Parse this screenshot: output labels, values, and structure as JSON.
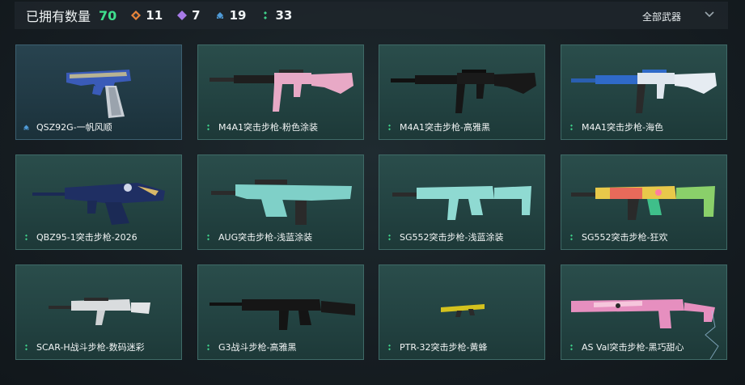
{
  "header": {
    "owned_label": "已拥有数量",
    "owned_count": "70",
    "rarities": [
      {
        "icon": "orange-diamond-icon",
        "color": "#e8843a",
        "count": "11"
      },
      {
        "icon": "purple-diamond-icon",
        "color": "#a77ae8",
        "count": "7"
      },
      {
        "icon": "blue-diamond-icon",
        "color": "#4f9bd8",
        "count": "19"
      },
      {
        "icon": "green-diamond-icon",
        "color": "#3fd08a",
        "count": "33"
      }
    ],
    "filter_label": "全部武器"
  },
  "weapons": [
    {
      "name": "QSZ92G-一帆风顺",
      "rarity_icon": "blue-diamond-icon",
      "rarity_color": "#4f9bd8"
    },
    {
      "name": "M4A1突击步枪-粉色涂装",
      "rarity_icon": "green-diamond-icon",
      "rarity_color": "#3fd08a"
    },
    {
      "name": "M4A1突击步枪-高雅黑",
      "rarity_icon": "green-diamond-icon",
      "rarity_color": "#3fd08a"
    },
    {
      "name": "M4A1突击步枪-海色",
      "rarity_icon": "green-diamond-icon",
      "rarity_color": "#3fd08a"
    },
    {
      "name": "QBZ95-1突击步枪-2026",
      "rarity_icon": "green-diamond-icon",
      "rarity_color": "#3fd08a"
    },
    {
      "name": "AUG突击步枪-浅蓝涂装",
      "rarity_icon": "green-diamond-icon",
      "rarity_color": "#3fd08a"
    },
    {
      "name": "SG552突击步枪-浅蓝涂装",
      "rarity_icon": "green-diamond-icon",
      "rarity_color": "#3fd08a"
    },
    {
      "name": "SG552突击步枪-狂欢",
      "rarity_icon": "green-diamond-icon",
      "rarity_color": "#3fd08a"
    },
    {
      "name": "SCAR-H战斗步枪-数码迷彩",
      "rarity_icon": "green-diamond-icon",
      "rarity_color": "#3fd08a"
    },
    {
      "name": "G3战斗步枪-高雅黑",
      "rarity_icon": "green-diamond-icon",
      "rarity_color": "#3fd08a"
    },
    {
      "name": "PTR-32突击步枪-黄蜂",
      "rarity_icon": "green-diamond-icon",
      "rarity_color": "#3fd08a"
    },
    {
      "name": "AS Val突击步枪-黑巧甜心",
      "rarity_icon": "green-diamond-icon",
      "rarity_color": "#3fd08a"
    }
  ]
}
